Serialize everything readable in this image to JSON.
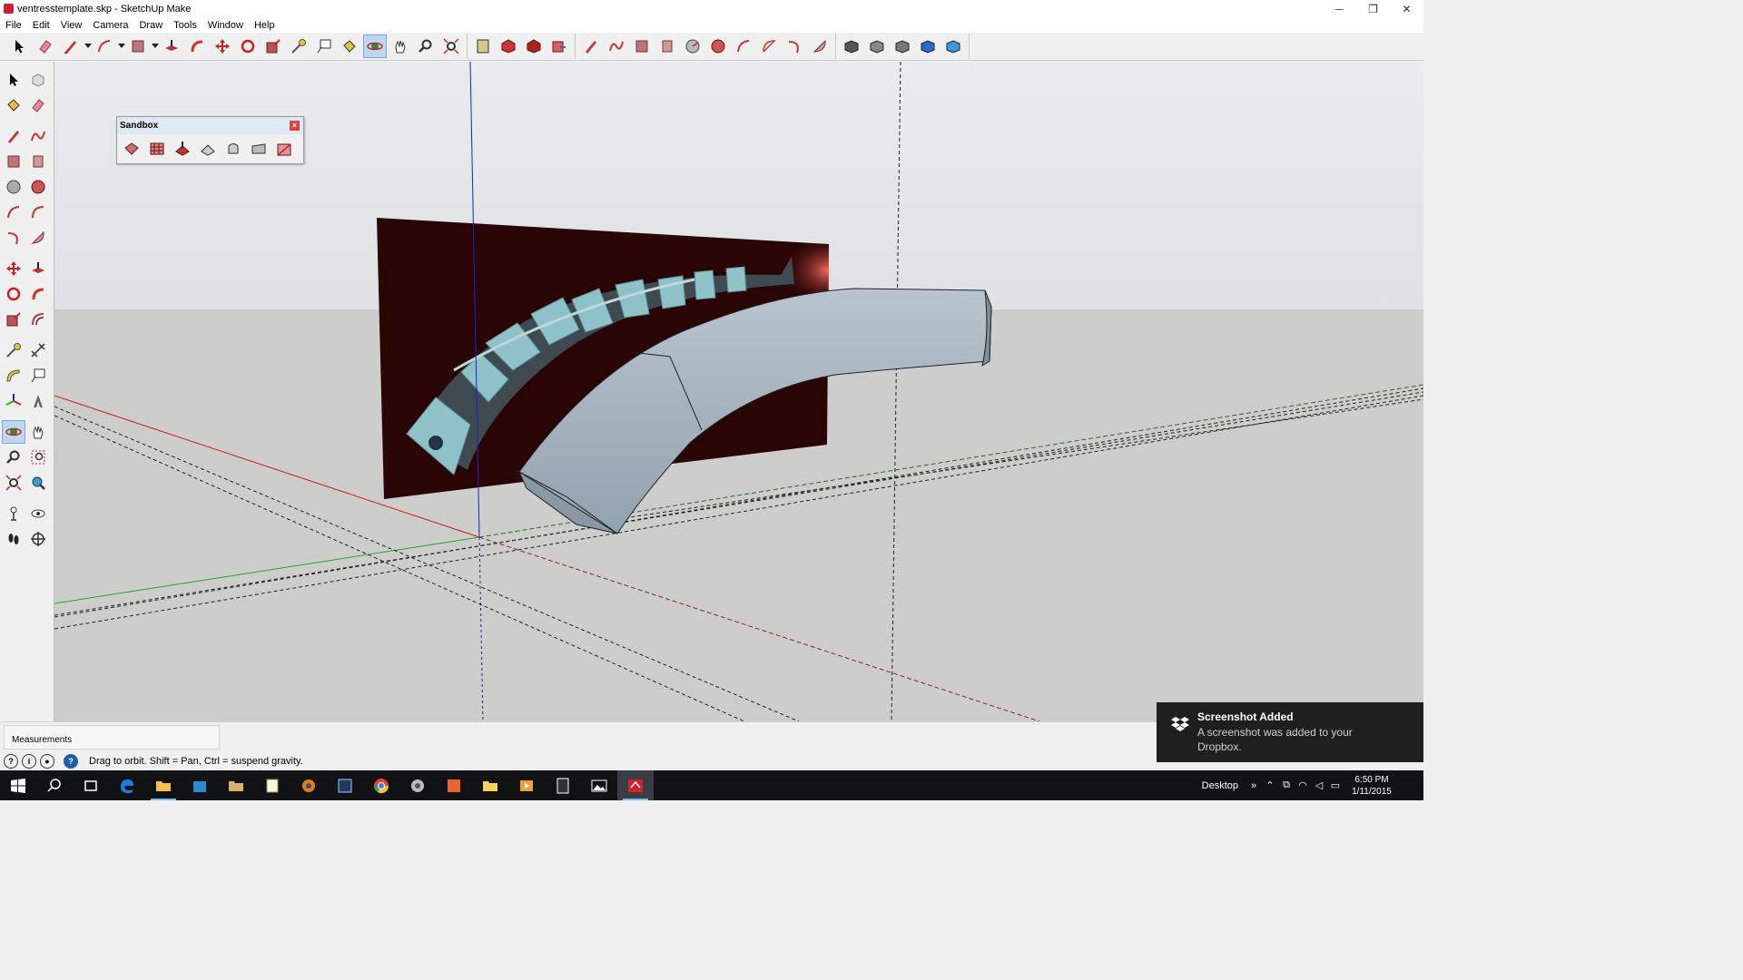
{
  "window": {
    "title": "ventresstemplate.skp - SketchUp Make",
    "minimize": "─",
    "restore": "❐",
    "close": "✕"
  },
  "menu": [
    "File",
    "Edit",
    "View",
    "Camera",
    "Draw",
    "Tools",
    "Window",
    "Help"
  ],
  "toolbar_top": {
    "groups": [
      [
        "select",
        "eraser",
        "line",
        "arc",
        "rectangle",
        "push-pull",
        "follow-me",
        "move",
        "rotate",
        "scale",
        "tape-measure",
        "text",
        "paint-bucket",
        "orbit",
        "pan",
        "zoom",
        "zoom-extents"
      ],
      [
        "section-plane",
        "3d-warehouse",
        "extension-warehouse",
        "send-to-layout"
      ],
      [
        "freehand",
        "rectangle",
        "rotated-rectangle",
        "circle",
        "polygon",
        "arc",
        "2pt-arc",
        "3pt-arc",
        "pie"
      ],
      [
        "shadows",
        "iso-view",
        "top-view",
        "front-view",
        "right-view"
      ]
    ]
  },
  "sandbox": {
    "title": "Sandbox",
    "close": "×",
    "tools": [
      "from-contours",
      "from-scratch",
      "smoove",
      "stamp",
      "drape",
      "add-detail",
      "flip-edge"
    ]
  },
  "measurements": {
    "label": "Measurements"
  },
  "status": {
    "text": "Drag to orbit. Shift = Pan, Ctrl = suspend gravity."
  },
  "toast": {
    "title": "Screenshot Added",
    "body": "A screenshot was added to your Dropbox."
  },
  "taskbar": {
    "apps": [
      "start",
      "search",
      "task-view",
      "edge",
      "file-explorer",
      "store",
      "folder",
      "notepad",
      "blender",
      "photo-app",
      "chrome",
      "tools-app",
      "office",
      "folder-yellow",
      "media-player",
      "calculator",
      "photos",
      "sketchup"
    ],
    "desktop_label": "Desktop",
    "overflow": "»",
    "time": "6:50 PM",
    "date": "1/11/2015"
  },
  "colors": {
    "sky": "#e2e5e7",
    "ground": "#cccdc9",
    "axis_red": "#cc2020",
    "axis_green": "#22aa22",
    "axis_blue": "#2020cc",
    "reference_plane": "#2a0505",
    "model_body": "#9aa9b6"
  }
}
